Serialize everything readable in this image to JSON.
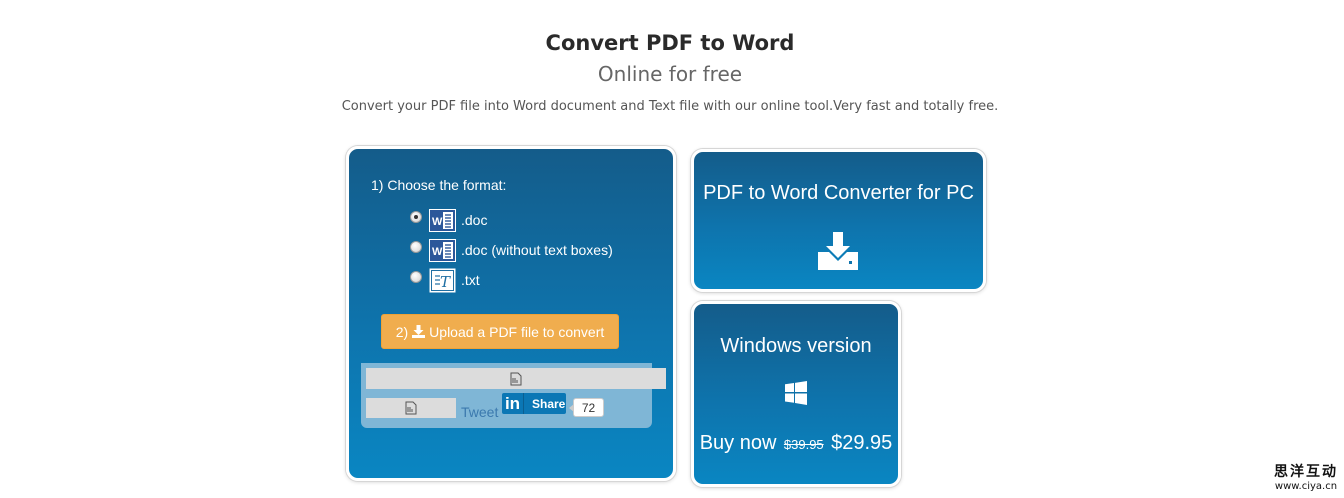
{
  "hero": {
    "title": "Convert PDF to Word",
    "subtitle": "Online for free",
    "description": "Convert your PDF file into Word document and Text file with our online tool.Very fast and totally free."
  },
  "converter": {
    "step1_label": "1) Choose the format:",
    "formats": [
      {
        "label": ".doc",
        "icon": "word-icon",
        "selected": true
      },
      {
        "label": ".doc (without text boxes)",
        "icon": "word-icon",
        "selected": false
      },
      {
        "label": ".txt",
        "icon": "text-file-icon",
        "selected": false
      }
    ],
    "upload_step": "2)",
    "upload_label": "Upload a PDF file to convert",
    "social": {
      "tweet_label": "Tweet",
      "linkedin_share_label": "Share",
      "share_count": "72"
    }
  },
  "pc_card": {
    "title": "PDF to Word Converter for PC",
    "icon": "download-icon"
  },
  "windows_card": {
    "title": "Windows version",
    "icon": "windows-logo-icon",
    "buy_label": "Buy now",
    "old_price": "$39.95",
    "new_price": "$29.95"
  },
  "watermark": {
    "name": "思洋互动",
    "url": "www.ciya.cn"
  },
  "colors": {
    "card_gradient_top": "#145c8a",
    "card_gradient_bottom": "#0a86c2",
    "upload_button": "#f0ad4e",
    "linkedin": "#0b77b5",
    "tweet_link": "#3b79ae"
  }
}
